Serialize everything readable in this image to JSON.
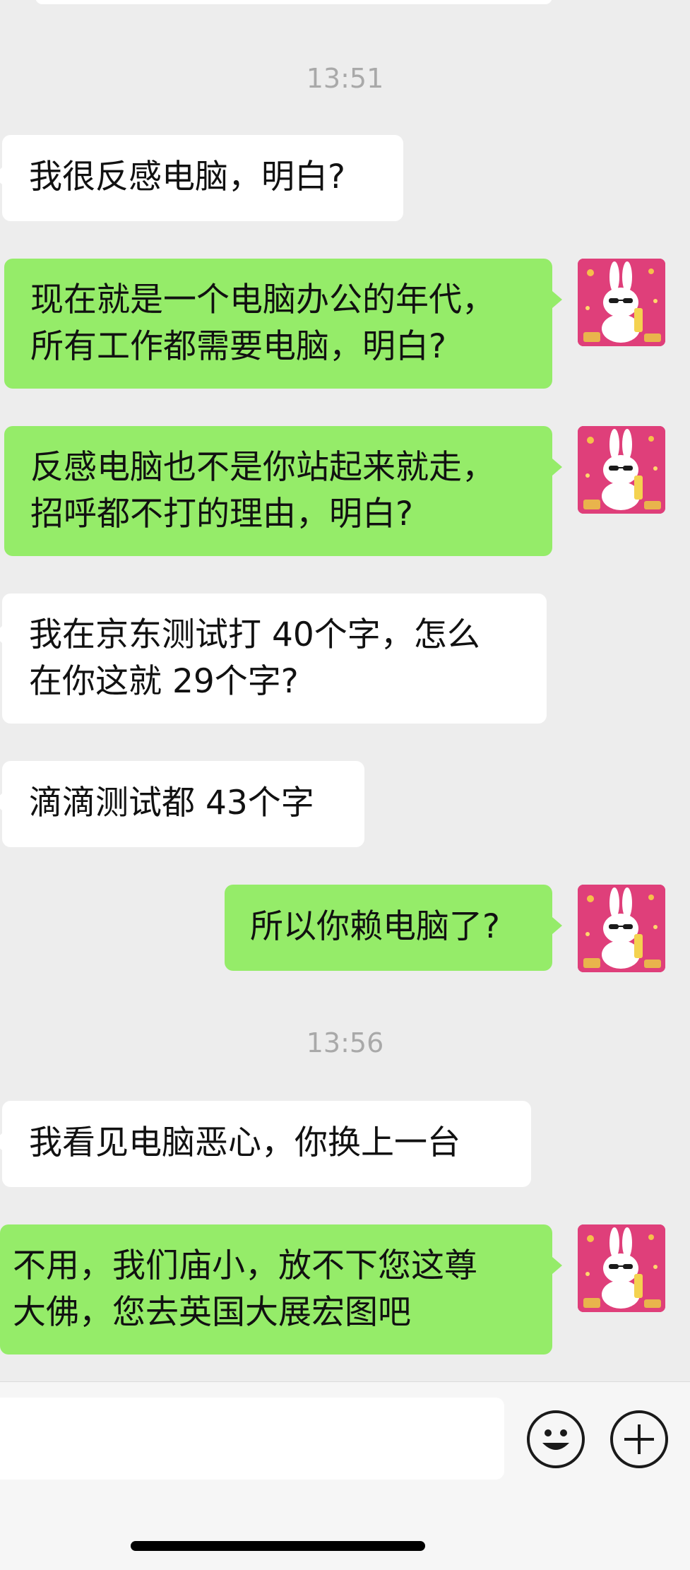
{
  "timestamps": [
    "13:51",
    "13:56"
  ],
  "messages": [
    {
      "side": "in",
      "lines": [
        "我很反感电脑，明白?"
      ]
    },
    {
      "side": "out",
      "lines": [
        "现在就是一个电脑办公的年代，",
        "所有工作都需要电脑，明白?"
      ]
    },
    {
      "side": "out",
      "lines": [
        "反感电脑也不是你站起来就走，",
        "招呼都不打的理由，明白?"
      ]
    },
    {
      "side": "in",
      "lines": [
        "我在京东测试打 40个字，怎么",
        "在你这就 29个字?"
      ]
    },
    {
      "side": "in",
      "lines": [
        "滴滴测试都 43个字"
      ]
    },
    {
      "side": "out",
      "lines": [
        "所以你赖电脑了?"
      ]
    },
    {
      "side": "in",
      "lines": [
        "我看见电脑恶心，你换上一台"
      ]
    },
    {
      "side": "out",
      "lines": [
        "不用，我们庙小，放不下您这尊",
        "大佛，您去英国大展宏图吧"
      ]
    }
  ],
  "avatar": {
    "icon": "rabbit-sunglasses-avatar",
    "background_color": "#df3f7a"
  },
  "colors": {
    "background": "#ededed",
    "incoming_bubble": "#ffffff",
    "outgoing_bubble": "#95ec69",
    "timestamp_text": "#a9a9a9"
  },
  "input_bar": {
    "value": "",
    "emoji_icon": "smiley-face-icon",
    "more_icon": "plus-circle-icon"
  }
}
